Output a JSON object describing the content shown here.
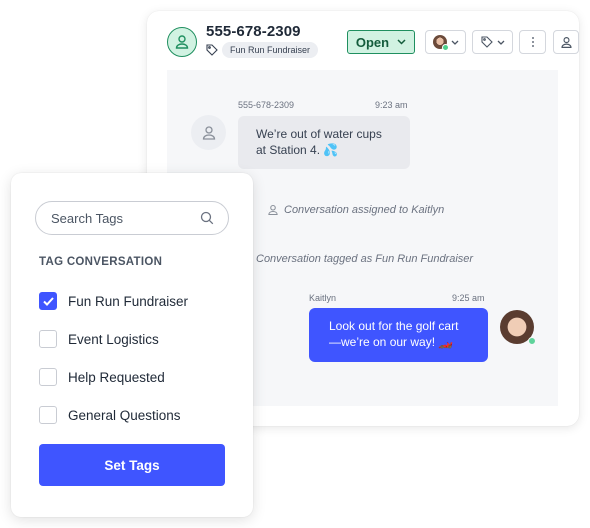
{
  "conversation": {
    "contact": {
      "phone": "555-678-2309",
      "tag": "Fun Run Fundraiser"
    },
    "status": {
      "label": "Open",
      "color": "#1f8f5f"
    },
    "header_buttons": {
      "assignee": "assignee-dropdown",
      "tags": "tags-dropdown",
      "more": "more-options",
      "profile": "contact-profile"
    },
    "messages": [
      {
        "direction": "incoming",
        "sender": "555-678-2309",
        "time": "9:23 am",
        "text": "We’re out of water cups at Station 4. 💦"
      },
      {
        "direction": "outgoing",
        "sender": "Kaitlyn",
        "time": "9:25 am",
        "text": "Look out for the golf cart—we’re on our way! 🏎️"
      }
    ],
    "events": [
      {
        "icon": "person-icon",
        "text": "Conversation assigned to Kaitlyn"
      },
      {
        "icon": "",
        "text": "Conversation tagged as Fun Run Fundraiser"
      }
    ]
  },
  "tag_panel": {
    "search_placeholder": "Search Tags",
    "section_title": "TAG CONVERSATION",
    "tags": [
      {
        "label": "Fun Run Fundraiser",
        "checked": true
      },
      {
        "label": "Event Logistics",
        "checked": false
      },
      {
        "label": "Help Requested",
        "checked": false
      },
      {
        "label": "General Questions",
        "checked": false
      }
    ],
    "submit_label": "Set Tags"
  },
  "colors": {
    "accent": "#3f55ff",
    "open_bg": "#d1f2e2",
    "online": "#5fd39b"
  }
}
